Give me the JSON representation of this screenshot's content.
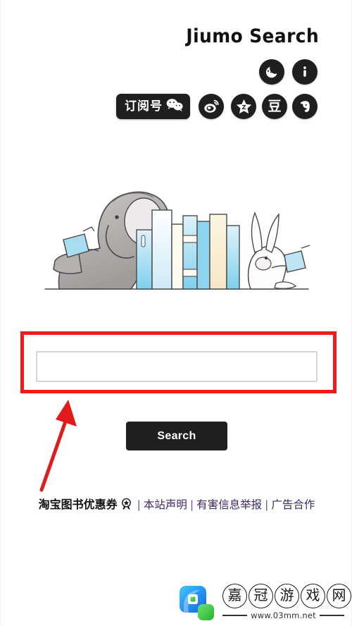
{
  "brand": {
    "title": "Jiumo Search"
  },
  "icon_row_top": [
    {
      "name": "moon-icon",
      "label": "Night mode"
    },
    {
      "name": "info-icon",
      "label": "About"
    }
  ],
  "icon_row_bottom": {
    "wechat_pill": {
      "text": "订阅号",
      "icon": "wechat-icon"
    },
    "socials": [
      {
        "name": "weibo-icon",
        "label": "Weibo"
      },
      {
        "name": "qzone-icon",
        "label": "QZone"
      },
      {
        "name": "douban-icon",
        "label": "豆"
      },
      {
        "name": "evernote-icon",
        "label": "Evernote"
      }
    ]
  },
  "illustration": {
    "name": "elephant-rabbit-books-illustration",
    "alt": "Elephant and rabbit reading beside a row of books"
  },
  "search": {
    "input_value": "",
    "placeholder": "",
    "button_label": "Search"
  },
  "annotation": {
    "box_color": "#ef1c1c",
    "arrow_color": "#e01b1b"
  },
  "footer": {
    "coupon_label": "淘宝图书优惠券",
    "coupon_icon": "award-badge-icon",
    "separator": "|",
    "links": [
      {
        "label": "本站声明"
      },
      {
        "label": "有害信息举报"
      },
      {
        "label": "广告合作"
      }
    ]
  },
  "watermark": {
    "chars": [
      "嘉",
      "冠",
      "游",
      "戏",
      "网"
    ],
    "url": "www.03mm.net",
    "logo_colors": {
      "blue": "#1d9bf0",
      "green": "#35c63a"
    }
  }
}
